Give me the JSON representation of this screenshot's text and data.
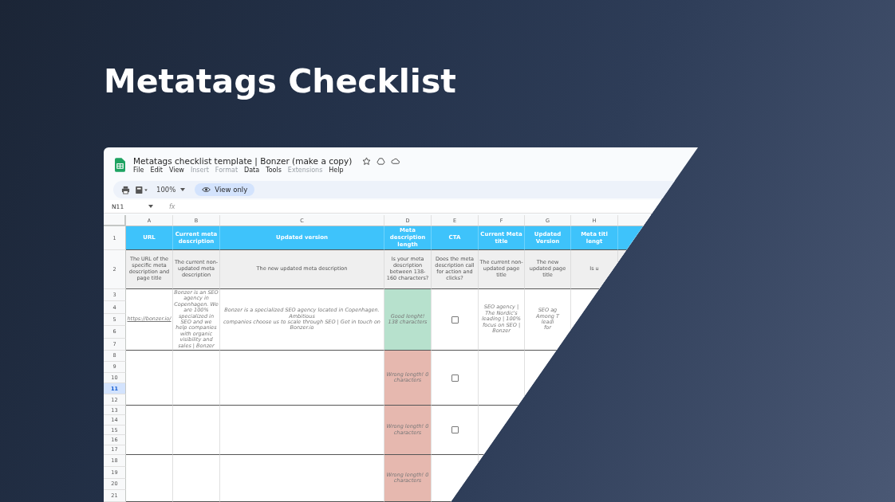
{
  "headline": "Metatags Checklist",
  "sheet": {
    "title": "Metatags checklist template | Bonzer (make a copy)",
    "menu": [
      {
        "label": "File",
        "disabled": false
      },
      {
        "label": "Edit",
        "disabled": false
      },
      {
        "label": "View",
        "disabled": false
      },
      {
        "label": "Insert",
        "disabled": true
      },
      {
        "label": "Format",
        "disabled": true
      },
      {
        "label": "Data",
        "disabled": false
      },
      {
        "label": "Tools",
        "disabled": false
      },
      {
        "label": "Extensions",
        "disabled": true
      },
      {
        "label": "Help",
        "disabled": false
      }
    ],
    "zoom": "100%",
    "mode": "View only",
    "cell_ref": "N11",
    "formula_label": "fx",
    "header_row": "1",
    "description_row": "2",
    "columns": [
      {
        "letter": "A",
        "header": "URL",
        "description": "The URL of the specific meta description and page title"
      },
      {
        "letter": "B",
        "header": "Current meta description",
        "description": "The current non-updated meta description"
      },
      {
        "letter": "C",
        "header": "Updated version",
        "description": "The new updated meta description"
      },
      {
        "letter": "D",
        "header": "Meta description length",
        "description": "Is your meta description between 138-160 characters?"
      },
      {
        "letter": "E",
        "header": "CTA",
        "description": "Does the meta description call for action and clicks?"
      },
      {
        "letter": "F",
        "header": "Current Meta title",
        "description": "The current non-updated page title"
      },
      {
        "letter": "G",
        "header": "Updated Version",
        "description": "The new updated page title"
      },
      {
        "letter": "H",
        "header": "Meta titl\nlengt",
        "description": "Is u"
      }
    ],
    "groups": [
      {
        "rows": [
          {
            "label": "3",
            "selected": false
          },
          {
            "label": "4",
            "selected": false
          },
          {
            "label": "5",
            "selected": false
          },
          {
            "label": "6",
            "selected": false
          },
          {
            "label": "7",
            "selected": false
          }
        ],
        "cells": [
          {
            "kind": "link",
            "text": "https://bonzer.io/"
          },
          {
            "kind": "text",
            "text": "Bonzer is an SEO agency in Copenhagen. We are 100% specialized in SEO and we\nhelp companies with organic visibility and sales | Bonzer"
          },
          {
            "kind": "text",
            "text": "Bonzer is a specialized SEO agency located in Copenhagen. Ambitious\ncompanies choose us to scale through SEO | Get in touch on Bonzer.io"
          },
          {
            "kind": "pass",
            "text": "Good lenght! 138 characters"
          },
          {
            "kind": "checkbox",
            "checked": false
          },
          {
            "kind": "text",
            "text": "SEO agency | The Nordic's leading | 100% focus on SEO | Bonzer"
          },
          {
            "kind": "text",
            "text": "SEO ag\nAmong T\nleadi\nfor"
          }
        ]
      },
      {
        "rows": [
          {
            "label": "8",
            "selected": false
          },
          {
            "label": "9",
            "selected": false
          },
          {
            "label": "10",
            "selected": false
          },
          {
            "label": "11",
            "selected": true
          },
          {
            "label": "12",
            "selected": false
          }
        ],
        "cells": [
          {
            "kind": "empty"
          },
          {
            "kind": "empty"
          },
          {
            "kind": "empty"
          },
          {
            "kind": "fail",
            "text": "Wrong length! 0 characters"
          },
          {
            "kind": "checkbox",
            "checked": false
          },
          {
            "kind": "empty"
          }
        ]
      },
      {
        "rows": [
          {
            "label": "13",
            "selected": false
          },
          {
            "label": "14",
            "selected": false
          },
          {
            "label": "15",
            "selected": false
          },
          {
            "label": "16",
            "selected": false
          },
          {
            "label": "17",
            "selected": false
          }
        ],
        "cells": [
          {
            "kind": "empty"
          },
          {
            "kind": "empty"
          },
          {
            "kind": "empty"
          },
          {
            "kind": "fail",
            "text": "Wrong length! 0 characters"
          },
          {
            "kind": "checkbox",
            "checked": false
          },
          {
            "kind": "empty"
          }
        ]
      },
      {
        "rows": [
          {
            "label": "18",
            "selected": false
          },
          {
            "label": "19",
            "selected": false
          },
          {
            "label": "20",
            "selected": false
          },
          {
            "label": "21",
            "selected": false
          }
        ],
        "cells": [
          {
            "kind": "empty"
          },
          {
            "kind": "empty"
          },
          {
            "kind": "empty"
          },
          {
            "kind": "fail",
            "text": "Wrong length! 0 characters"
          },
          {
            "kind": "empty"
          }
        ]
      }
    ]
  }
}
